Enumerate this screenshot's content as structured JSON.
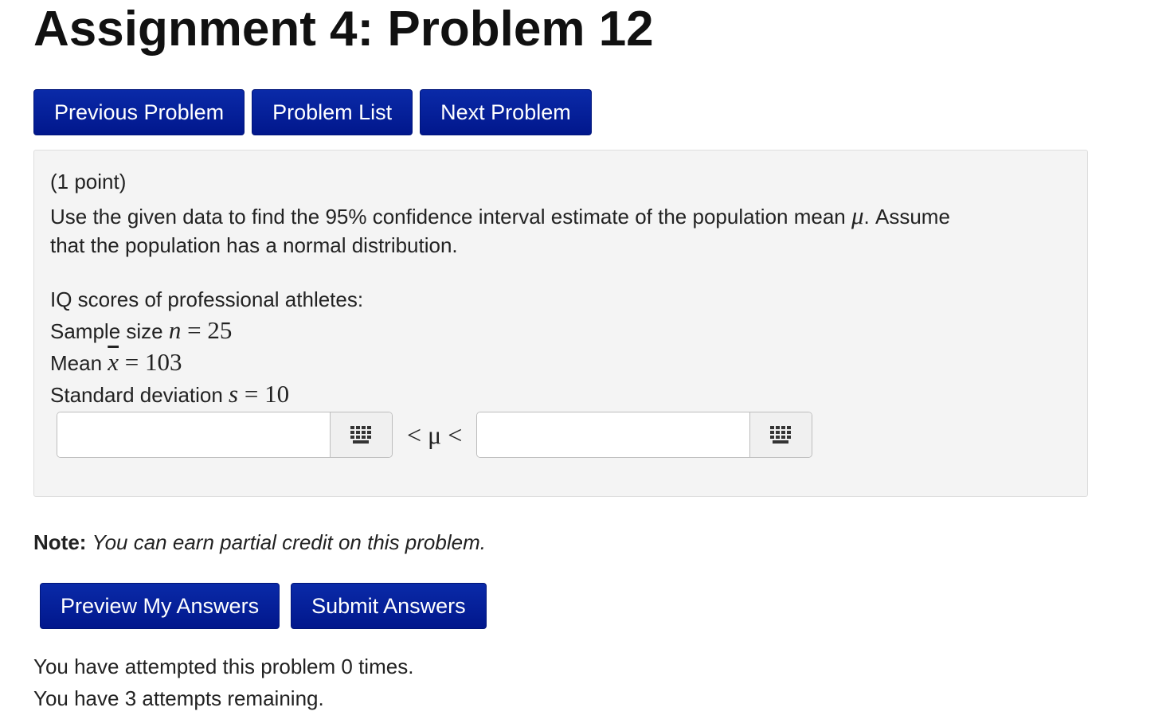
{
  "page": {
    "title": "Assignment 4: Problem 12"
  },
  "nav": {
    "previous_label": "Previous Problem",
    "list_label": "Problem List",
    "next_label": "Next Problem"
  },
  "problem": {
    "points": "(1 point)",
    "statement_line1_pre": "Use the given data to find the 95% confidence interval estimate of the population mean ",
    "mu_symbol": "μ",
    "statement_line1_post": ". Assume",
    "statement_line2": "that the population has a normal distribution.",
    "data_heading": "IQ scores of professional athletes:",
    "sample_size_label": "Sample size ",
    "sample_size_var": "n",
    "sample_size_value": "25",
    "mean_label": "Mean ",
    "mean_var": "x",
    "mean_value": "103",
    "sd_label": "Standard deviation ",
    "sd_var": "s",
    "sd_value": "10",
    "equals": " = ",
    "interval_middle": "< μ <",
    "lower_answer": "",
    "upper_answer": ""
  },
  "note": {
    "label": "Note:",
    "text": "You can earn partial credit on this problem."
  },
  "actions": {
    "preview_label": "Preview My Answers",
    "submit_label": "Submit Answers"
  },
  "status": {
    "attempts_made": "You have attempted this problem 0 times.",
    "attempts_remaining": "You have 3 attempts remaining."
  },
  "colors": {
    "button_blue": "#01178c",
    "panel_bg": "#f4f4f4"
  },
  "icons": {
    "equation_editor": "grid-keypad-icon"
  }
}
